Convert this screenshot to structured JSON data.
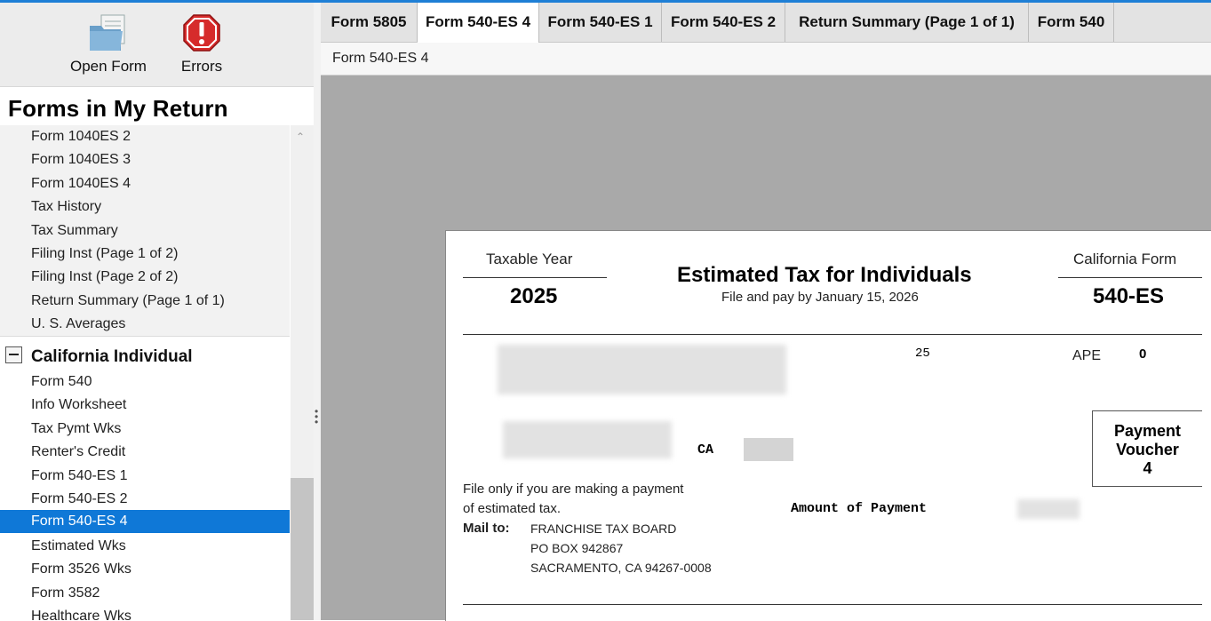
{
  "toolbar": {
    "open_form": "Open Form",
    "errors": "Errors"
  },
  "sidebar": {
    "title": "Forms in My Return",
    "group1_items": [
      "Form 1040ES 2",
      "Form 1040ES 3",
      "Form 1040ES 4",
      "Tax History",
      "Tax Summary",
      "Filing Inst (Page 1 of 2)",
      "Filing Inst (Page 2 of 2)",
      "Return Summary (Page 1 of 1)",
      "U. S. Averages"
    ],
    "group2_label": "California Individual",
    "group2_items": [
      "Form 540",
      "Info Worksheet",
      "Tax Pymt Wks",
      "Renter's Credit",
      "Form 540-ES 1",
      "Form 540-ES 2",
      "Form 540-ES 4",
      "Estimated Wks",
      "Form 3526 Wks",
      "Form 3582",
      "Healthcare Wks"
    ],
    "selected_item": "Form 540-ES 4"
  },
  "tabs": [
    "Form 5805",
    "Form 540-ES 4",
    "Form 540-ES 1",
    "Form 540-ES 2",
    "Return Summary (Page 1 of 1)",
    "Form 540"
  ],
  "active_tab": "Form 540-ES 4",
  "subbar_title": "Form 540-ES 4",
  "document": {
    "taxable_year_label": "Taxable Year",
    "year": "2025",
    "title": "Estimated Tax for Individuals",
    "subtitle": "File and pay by January 15, 2026",
    "california_form_label": "California Form",
    "form_number": "540-ES",
    "code_25": "25",
    "ape_label": "APE",
    "ape_value": "0",
    "state": "CA",
    "voucher_line1": "Payment",
    "voucher_line2": "Voucher",
    "voucher_number": "4",
    "file_only_line1": "File only if you are making a payment",
    "file_only_line2": "of estimated tax.",
    "mail_to_label": "Mail to:",
    "mail_line1": "FRANCHISE TAX BOARD",
    "mail_line2": "PO BOX 942867",
    "mail_line3": "SACRAMENTO, CA 94267-0008",
    "amount_label": "Amount of Payment"
  },
  "icons": {
    "open_form": "folder-document-icon",
    "errors": "error-stop-icon"
  },
  "colors": {
    "selection": "#0f78d7",
    "error_red": "#d62b2b",
    "top_accent": "#1e7fd6"
  }
}
